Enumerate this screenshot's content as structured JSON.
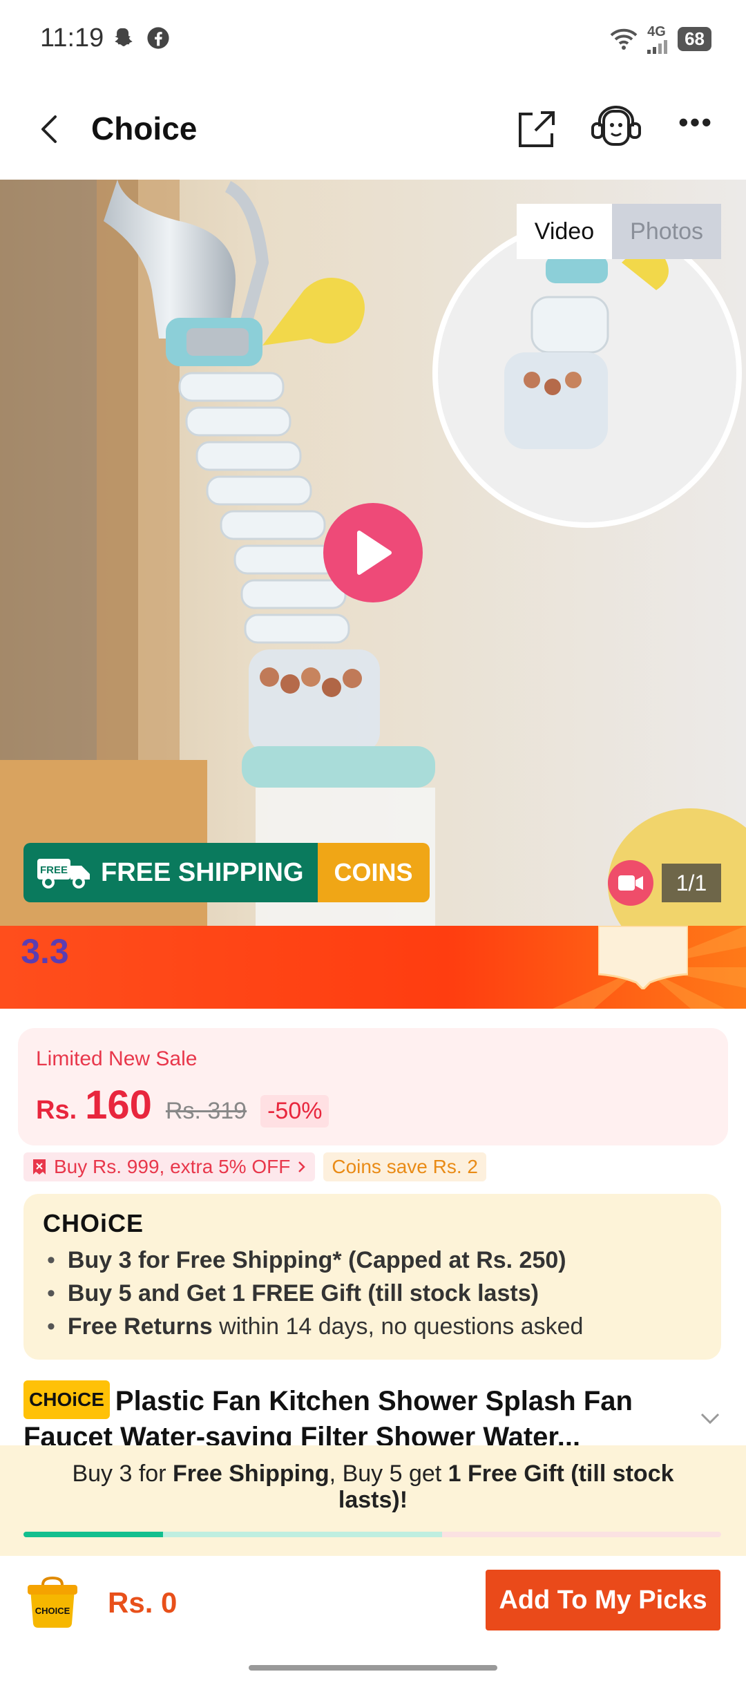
{
  "status_bar": {
    "time": "11:19",
    "network": "4G",
    "battery": "68"
  },
  "header": {
    "title": "Choice"
  },
  "gallery": {
    "tabs": [
      "Video",
      "Photos"
    ],
    "free_shipping_label": "FREE SHIPPING",
    "free_truck_label": "FREE",
    "coins_label": "COINS",
    "counter": "1/1"
  },
  "promo": {
    "badge": "3.3"
  },
  "price": {
    "sale_label": "Limited New Sale",
    "currency": "Rs.",
    "current": "160",
    "original": "Rs. 319",
    "discount": "-50%"
  },
  "coupons": {
    "extra_off": "Buy Rs. 999, extra 5% OFF",
    "coins_save": "Coins save Rs. 2"
  },
  "choice": {
    "logo": "CHOiCE",
    "benefit_1": "Buy 3 for  Free Shipping* (Capped at Rs. 250)",
    "benefit_2": "Buy 5 and Get 1 FREE Gift (till stock lasts)",
    "benefit_3_bold": "Free Returns",
    "benefit_3_rest": "within 14 days, no questions asked"
  },
  "product": {
    "tag": "CHOiCE",
    "title": "Plastic Fan Kitchen Shower Splash Fan Faucet Water-saving Filter Shower Water..."
  },
  "progress": {
    "text_1": "Buy 3 for ",
    "text_2": "Free Shipping",
    "text_3": ", Buy 5 get ",
    "text_4": "1 Free Gift (till stock lasts)",
    "text_5": "!",
    "fill_fraction": 0.2
  },
  "bottom_bar": {
    "cart_label": "CHOICE",
    "total": "Rs. 0",
    "add_button": "Add To My Picks"
  },
  "colors": {
    "accent": "#ea4a1a",
    "price_red": "#e8263d",
    "choice_yellow": "#fdf3d8",
    "progress_green": "#13bf8e"
  }
}
